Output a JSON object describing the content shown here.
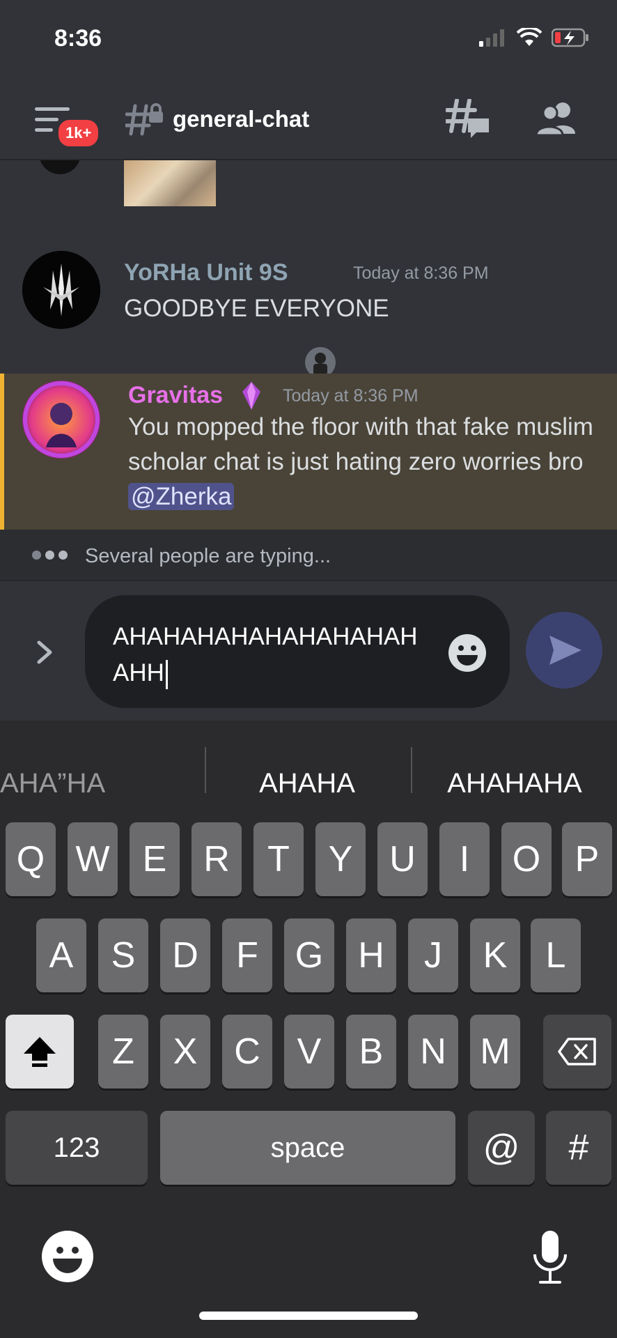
{
  "status_bar": {
    "time": "8:36"
  },
  "header": {
    "notifications_badge": "1k+",
    "channel_name": "general-chat"
  },
  "messages": [
    {
      "username": "YoRHa Unit 9S",
      "username_color": "#8fa4b3",
      "timestamp": "Today at 8:36 PM",
      "text": "GOODBYE EVERYONE"
    },
    {
      "username": "Gravitas",
      "username_color": "#e770e8",
      "timestamp": "Today at 8:36 PM",
      "text": "You mopped the floor with that fake muslim scholar chat is just hating zero worries bro",
      "mention": "@Zherka",
      "highlighted": true
    }
  ],
  "typing_indicator": "Several people are typing...",
  "composer": {
    "value": "AHAHAHAHAHAHAHAHAHAHH"
  },
  "keyboard": {
    "suggestions": [
      "AHA”HA",
      "AHAHA",
      "AHAHAHA"
    ],
    "row1": [
      "Q",
      "W",
      "E",
      "R",
      "T",
      "Y",
      "U",
      "I",
      "O",
      "P"
    ],
    "row2": [
      "A",
      "S",
      "D",
      "F",
      "G",
      "H",
      "J",
      "K",
      "L"
    ],
    "row3": [
      "Z",
      "X",
      "C",
      "V",
      "B",
      "N",
      "M"
    ],
    "numbers_label": "123",
    "space_label": "space",
    "at_label": "@",
    "hash_label": "#"
  },
  "colors": {
    "accent": "#5865f2",
    "badge": "#f23f43",
    "highlight_bar": "#f0b232"
  }
}
